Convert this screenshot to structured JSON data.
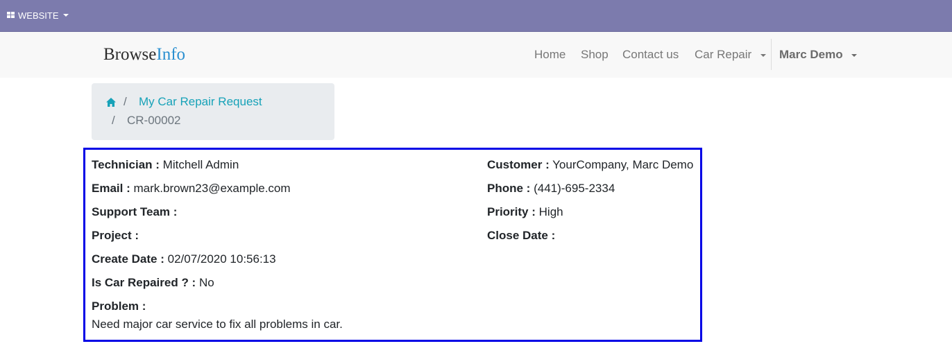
{
  "topbar": {
    "website_menu": "WEBSITE"
  },
  "navbar": {
    "brand_part1": "Browse",
    "brand_part2": "Info",
    "items": [
      "Home",
      "Shop",
      "Contact us",
      "Car Repair"
    ],
    "user": "Marc Demo"
  },
  "breadcrumb": {
    "separator": "/",
    "link": "My Car Repair Request",
    "active": "CR-00002"
  },
  "details": {
    "technician": {
      "label": "Technician :",
      "value": "Mitchell Admin"
    },
    "email": {
      "label": "Email :",
      "value": "mark.brown23@example.com"
    },
    "support_team": {
      "label": "Support Team :",
      "value": ""
    },
    "project": {
      "label": "Project :",
      "value": ""
    },
    "create_date": {
      "label": "Create Date :",
      "value": "02/07/2020 10:56:13"
    },
    "is_car_repaired": {
      "label": "Is Car Repaired ? :",
      "value": "No"
    },
    "problem": {
      "label": "Problem :",
      "value": "Need major car service to fix all problems in car."
    },
    "customer": {
      "label": "Customer :",
      "value": "YourCompany, Marc Demo"
    },
    "phone": {
      "label": "Phone :",
      "value": "(441)-695-2334"
    },
    "priority": {
      "label": "Priority :",
      "value": "High"
    },
    "close_date": {
      "label": "Close Date :",
      "value": ""
    }
  },
  "colors": {
    "topbar": "#7c7bad",
    "highlight_border": "#0000e6",
    "link": "#17a2b8"
  },
  "icons": [
    "grid-icon",
    "caret-down-icon",
    "home-icon"
  ]
}
